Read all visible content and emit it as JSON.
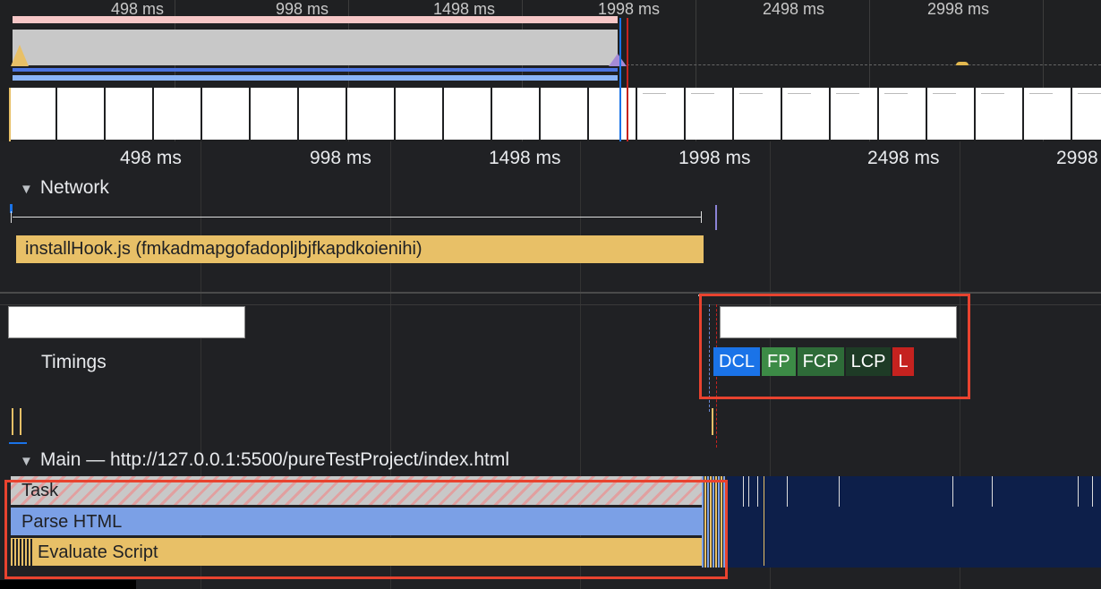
{
  "overview": {
    "ticks": [
      "498 ms",
      "998 ms",
      "1498 ms",
      "1998 ms",
      "2498 ms",
      "2998 ms"
    ]
  },
  "ruler": {
    "ticks": [
      "498 ms",
      "998 ms",
      "1498 ms",
      "1998 ms",
      "2498 ms",
      "2998"
    ]
  },
  "network": {
    "header": "Network",
    "request_label": "installHook.js (fmkadmapgofadopljbjfkapdkoienihi)"
  },
  "timings": {
    "header": "Timings",
    "markers": [
      {
        "label": "DCL",
        "color": "#1a73e8"
      },
      {
        "label": "FP",
        "color": "#3c8b46"
      },
      {
        "label": "FCP",
        "color": "#2e6b38"
      },
      {
        "label": "LCP",
        "color": "#1e3b26"
      },
      {
        "label": "L",
        "color": "#c5221f"
      }
    ]
  },
  "main": {
    "header": "Main — http://127.0.0.1:5500/pureTestProject/index.html",
    "tracks": {
      "task": "Task",
      "parse_html": "Parse HTML",
      "evaluate_script": "Evaluate Script"
    }
  },
  "colors": {
    "highlight": "#e8432f",
    "script": "#e8c067",
    "parse": "#7ba0e6"
  }
}
